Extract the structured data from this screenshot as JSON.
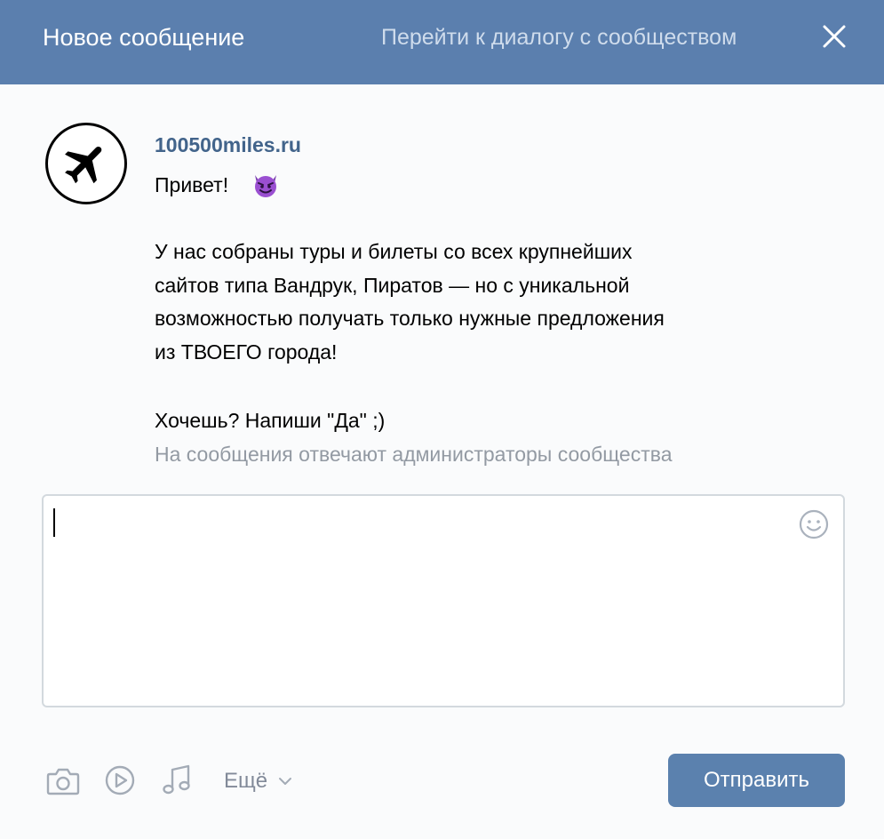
{
  "header": {
    "title": "Новое сообщение",
    "link": "Перейти к диалогу с сообществом",
    "close_icon": "close-icon"
  },
  "message": {
    "sender": "100500miles.ru",
    "avatar_icon": "airplane-icon",
    "lines": [
      "Привет!",
      "У нас собраны туры и билеты со всех крупнейших",
      "сайтов типа Вандрук, Пиратов — но с уникальной",
      "возможностью получать только нужные предложения",
      "из ТВОЕГО города!",
      "Хочешь? Напиши \"Да\" ;)"
    ],
    "emoji": "smiling-devil-emoji"
  },
  "note": "На сообщения отвечают администраторы сообщества",
  "composer": {
    "value": "",
    "emoji_icon": "smile-icon"
  },
  "toolbar": {
    "icons": [
      "camera-icon",
      "video-icon",
      "music-icon"
    ],
    "more_label": "Ещё",
    "send_label": "Отправить"
  },
  "colors": {
    "header_bg": "#5b7fae",
    "link": "#42648b",
    "button": "#5b81ae"
  }
}
